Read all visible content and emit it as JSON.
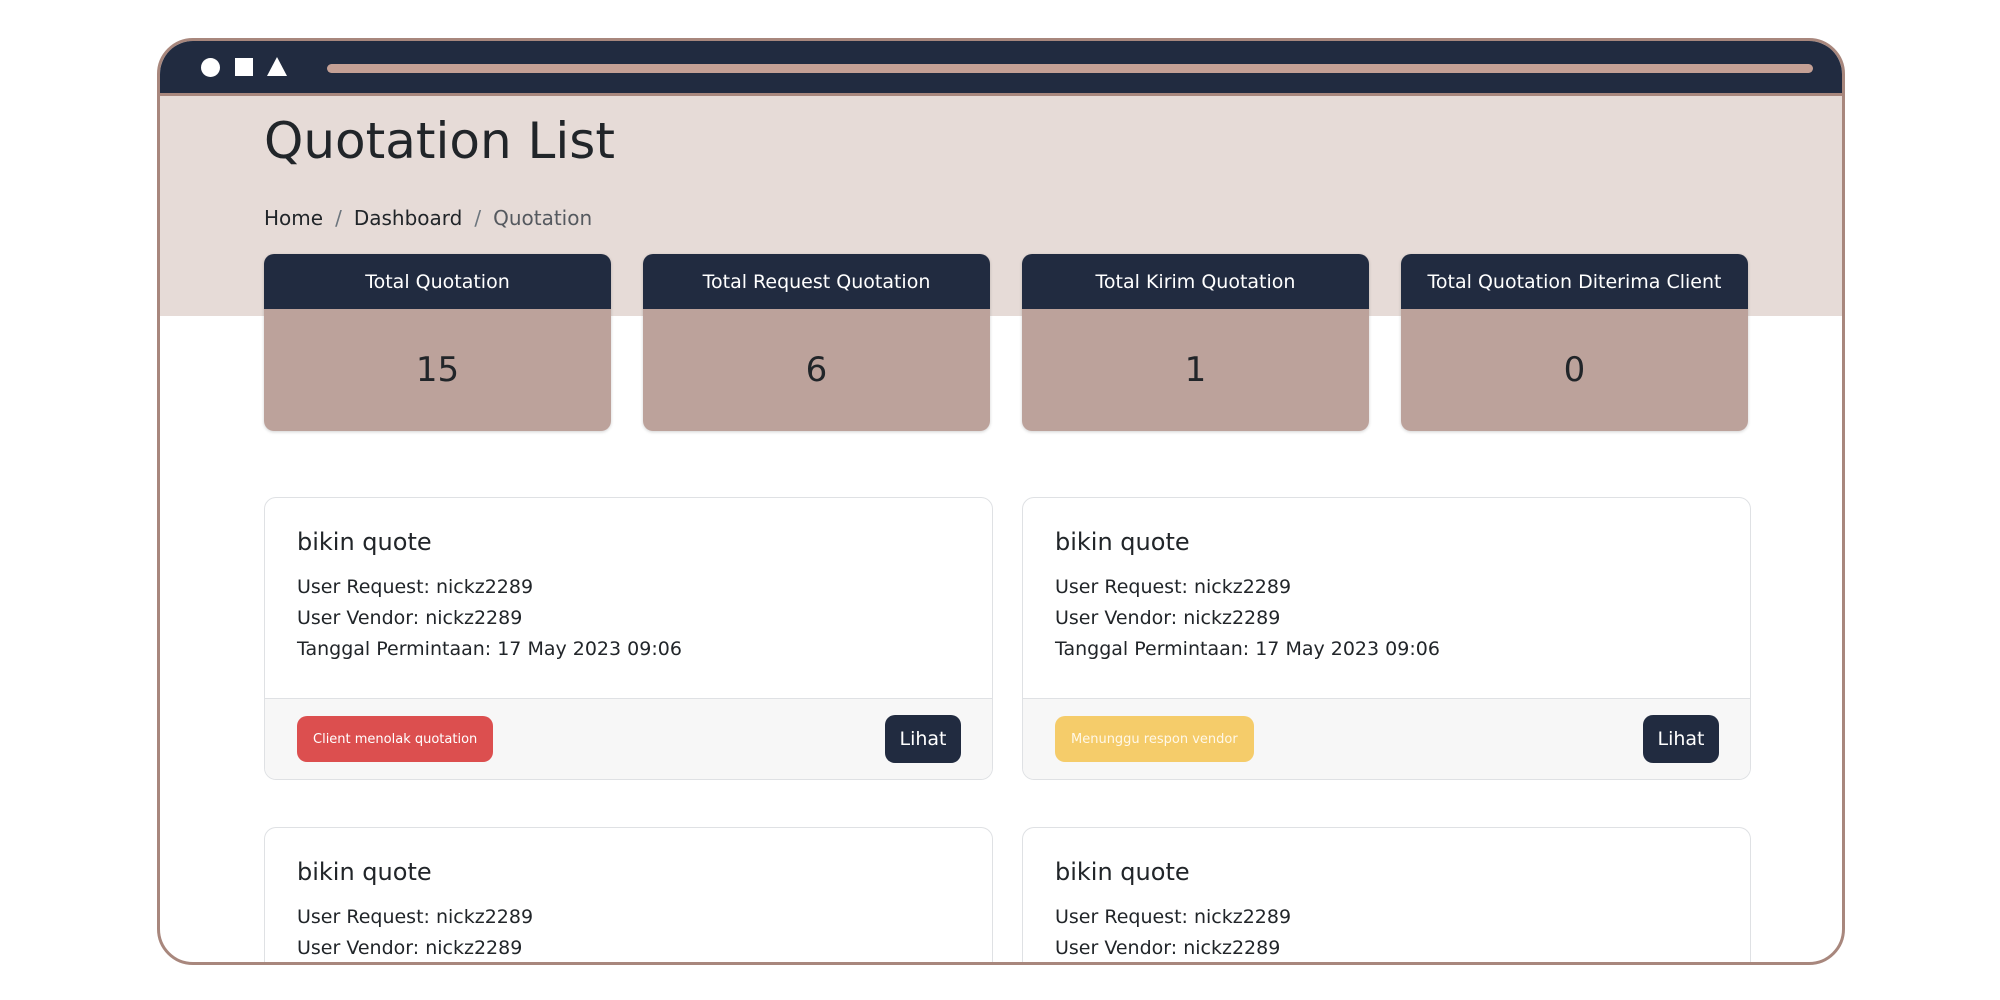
{
  "window": {
    "controls": [
      "circle-icon",
      "square-icon",
      "triangle-icon"
    ]
  },
  "page": {
    "title": "Quotation List"
  },
  "breadcrumb": {
    "items": [
      "Home",
      "Dashboard",
      "Quotation"
    ],
    "separator": "/"
  },
  "stats": [
    {
      "label": "Total Quotation",
      "value": "15"
    },
    {
      "label": "Total Request Quotation",
      "value": "6"
    },
    {
      "label": "Total Kirim Quotation",
      "value": "1"
    },
    {
      "label": "Total Quotation Diterima Client",
      "value": "0"
    }
  ],
  "quotes": [
    {
      "title": "bikin quote",
      "user_request": "User Request: nickz2289",
      "user_vendor": "User Vendor: nickz2289",
      "tanggal": "Tanggal Permintaan: 17 May 2023 09:06",
      "status": "Client menolak quotation",
      "status_color": "#dc4f4f",
      "button": "Lihat"
    },
    {
      "title": "bikin quote",
      "user_request": "User Request: nickz2289",
      "user_vendor": "User Vendor: nickz2289",
      "tanggal": "Tanggal Permintaan: 17 May 2023 09:06",
      "status": "Menunggu respon vendor",
      "status_color": "#f5cc6a",
      "button": "Lihat"
    },
    {
      "title": "bikin quote",
      "user_request": "User Request: nickz2289",
      "user_vendor": "User Vendor: nickz2289"
    },
    {
      "title": "bikin quote",
      "user_request": "User Request: nickz2289",
      "user_vendor": "User Vendor: nickz2289"
    }
  ],
  "colors": {
    "navy": "#212b40",
    "hero": "#e6dbd7",
    "stat_body": "#bca29b",
    "frame": "#a8877d"
  }
}
